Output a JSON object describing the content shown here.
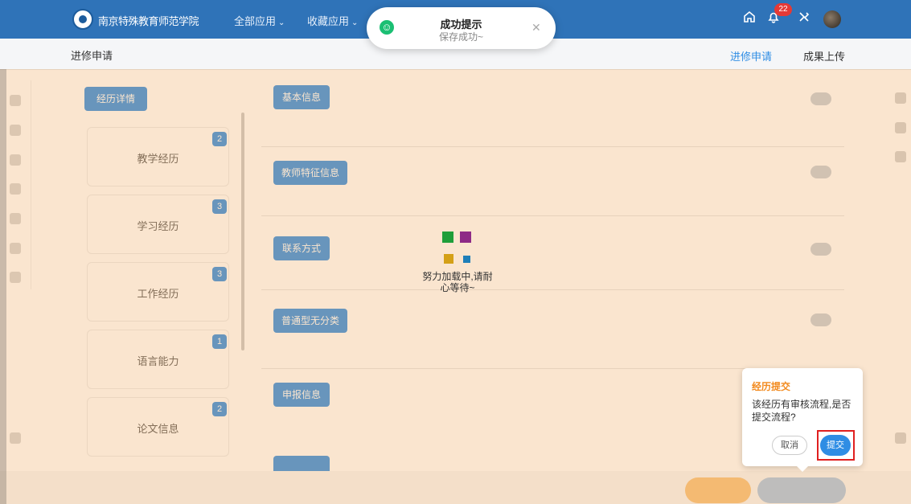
{
  "topbar": {
    "school_name": "南京特殊教育师范学院",
    "menu_all_apps": "全部应用",
    "menu_favorites": "收藏应用",
    "notification_count": "22"
  },
  "subheader": {
    "breadcrumb": "进修申请",
    "tab_apply": "进修申请",
    "tab_upload": "成果上传"
  },
  "background": {
    "experience_details": "经历详情",
    "experience_cards": [
      {
        "label": "教学经历",
        "count": "2"
      },
      {
        "label": "学习经历",
        "count": "3"
      },
      {
        "label": "工作经历",
        "count": "3"
      },
      {
        "label": "语言能力",
        "count": "1"
      },
      {
        "label": "论文信息",
        "count": "2"
      }
    ],
    "sections": [
      "基本信息",
      "教师特征信息",
      "联系方式",
      "普通型无分类",
      "申报信息"
    ]
  },
  "loader": {
    "text": "努力加载中,请耐心等待~",
    "colors": [
      "#1f9e3a",
      "#8e2a86",
      "#d4a017",
      "#1f7fb8"
    ]
  },
  "toast": {
    "title": "成功提示",
    "message": "保存成功~"
  },
  "popover": {
    "title": "经历提交",
    "message": "该经历有审核流程,是否提交流程?",
    "cancel": "取消",
    "submit": "提交"
  },
  "colors": {
    "primary": "#2f73b8",
    "accent_blue": "#2f8de4",
    "warning_orange": "#f28a1e",
    "highlight_red": "#e02020"
  }
}
